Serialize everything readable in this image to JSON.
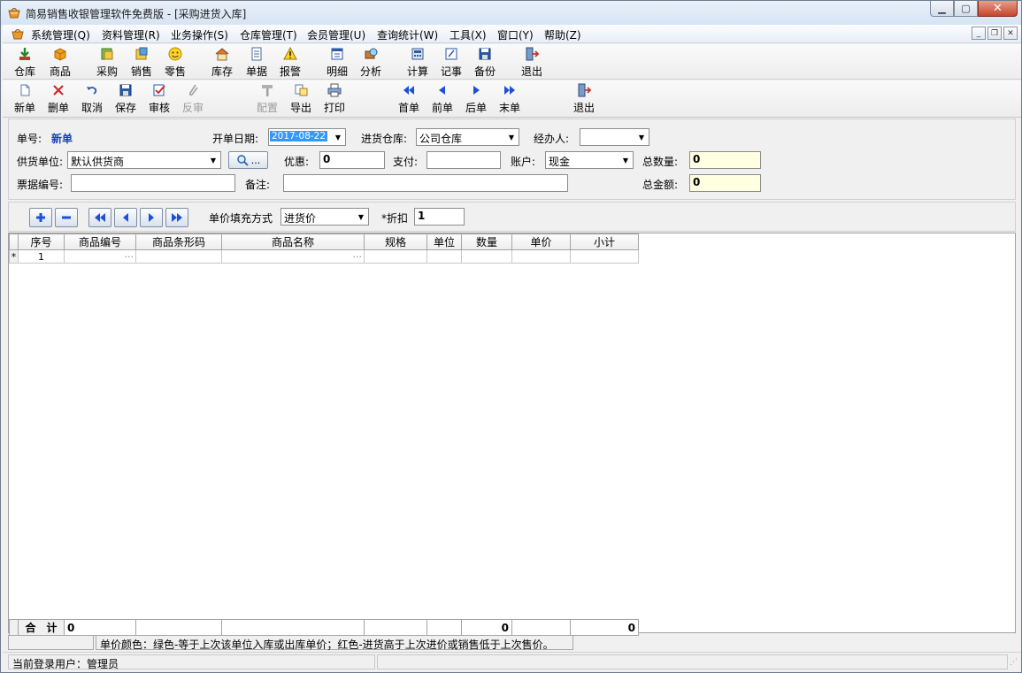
{
  "window": {
    "title": "简易销售收银管理软件免费版 - [采购进货入库]",
    "icon": "basket-icon"
  },
  "menu": {
    "items": [
      "系统管理(Q)",
      "资料管理(R)",
      "业务操作(S)",
      "仓库管理(T)",
      "会员管理(U)",
      "查询统计(W)",
      "工具(X)",
      "窗口(Y)",
      "帮助(Z)"
    ]
  },
  "toolbar1": {
    "items": [
      {
        "label": "仓库",
        "icon": "warehouse-icon"
      },
      {
        "label": "商品",
        "icon": "box-icon"
      },
      {
        "label": "采购",
        "icon": "purchase-icon"
      },
      {
        "label": "销售",
        "icon": "sales-icon"
      },
      {
        "label": "零售",
        "icon": "smiley-icon"
      },
      {
        "label": "库存",
        "icon": "house-icon"
      },
      {
        "label": "单据",
        "icon": "document-icon"
      },
      {
        "label": "报警",
        "icon": "warning-icon"
      },
      {
        "label": "明细",
        "icon": "calendar-icon"
      },
      {
        "label": "分析",
        "icon": "analysis-icon"
      },
      {
        "label": "计算",
        "icon": "calculator-icon"
      },
      {
        "label": "记事",
        "icon": "notepad-icon"
      },
      {
        "label": "备份",
        "icon": "floppy-icon"
      },
      {
        "label": "退出",
        "icon": "exit-icon"
      }
    ]
  },
  "toolbar2": {
    "items": [
      {
        "label": "新单",
        "icon": "new-doc-icon",
        "enabled": true
      },
      {
        "label": "删单",
        "icon": "delete-x-icon",
        "enabled": true
      },
      {
        "label": "取消",
        "icon": "undo-icon",
        "enabled": true
      },
      {
        "label": "保存",
        "icon": "save-icon",
        "enabled": true
      },
      {
        "label": "审核",
        "icon": "approve-icon",
        "enabled": true
      },
      {
        "label": "反审",
        "icon": "unapprove-icon",
        "enabled": false
      },
      {
        "label": "配置",
        "icon": "hammer-icon",
        "enabled": false
      },
      {
        "label": "导出",
        "icon": "export-icon",
        "enabled": true
      },
      {
        "label": "打印",
        "icon": "printer-icon",
        "enabled": true
      },
      {
        "label": "首单",
        "icon": "first-icon",
        "enabled": true
      },
      {
        "label": "前单",
        "icon": "prev-icon",
        "enabled": true
      },
      {
        "label": "后单",
        "icon": "next-icon",
        "enabled": true
      },
      {
        "label": "末单",
        "icon": "last-icon",
        "enabled": true
      },
      {
        "label": "退出",
        "icon": "exit-icon",
        "enabled": true
      }
    ]
  },
  "form": {
    "order_no_label": "单号:",
    "order_no_value": "新单",
    "date_label": "开单日期:",
    "date_value": "2017-08-22",
    "warehouse_label": "进货仓库:",
    "warehouse_value": "公司仓库",
    "handler_label": "经办人:",
    "handler_value": "",
    "supplier_label": "供货单位:",
    "supplier_value": "默认供货商",
    "search_label": "...",
    "discount_label": "优惠:",
    "discount_value": "0",
    "payment_label": "支付:",
    "payment_value": "",
    "account_label": "账户:",
    "account_value": "现金",
    "total_qty_label": "总数量:",
    "total_qty_value": "0",
    "invoice_label": "票据编号:",
    "invoice_value": "",
    "remark_label": "备注:",
    "remark_value": "",
    "total_amount_label": "总金额:",
    "total_amount_value": "0"
  },
  "rowtools": {
    "price_fill_label": "单价填充方式",
    "price_fill_value": "进货价",
    "discount_label": "*折扣",
    "discount_value": "1"
  },
  "grid": {
    "columns": [
      "序号",
      "商品编号",
      "商品条形码",
      "商品名称",
      "规格",
      "单位",
      "数量",
      "单价",
      "小计"
    ],
    "rows": [
      {
        "marker": "*",
        "seq": "1",
        "code_ellipsis": "···",
        "name_ellipsis": "···"
      }
    ],
    "footer": {
      "label": "合　计",
      "first": "0",
      "qty": "0",
      "subtotal": "0"
    }
  },
  "status": {
    "legend": "单价颜色：绿色-等于上次该单位入库或出库单价；红色-进货高于上次进价或销售低于上次售价。",
    "user": "当前登录用户：管理员"
  },
  "colors": {
    "order_no": "#1a3fbf",
    "highlight": "#3399ff",
    "yellow_field": "#ffffe1",
    "nav_blue": "#1f4fd6"
  }
}
